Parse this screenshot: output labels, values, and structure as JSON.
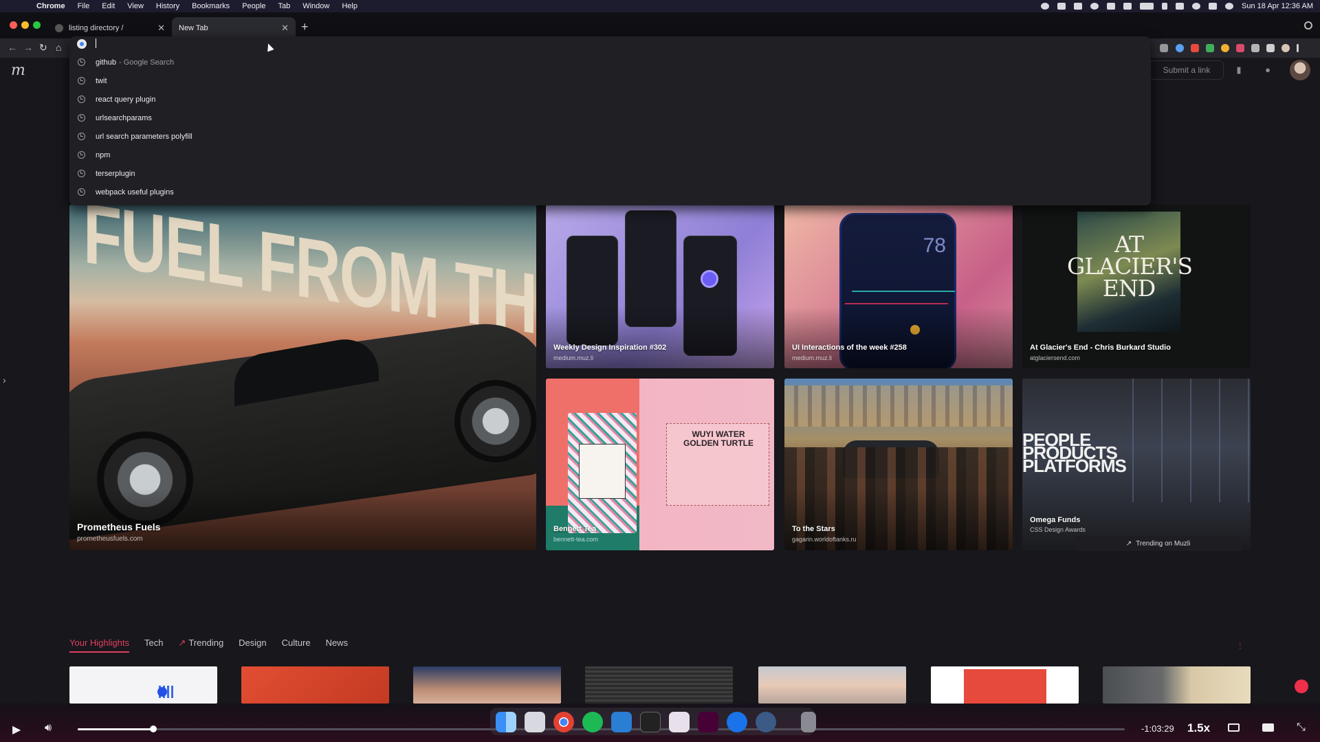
{
  "menubar": {
    "app_name": "Chrome",
    "items": [
      "File",
      "Edit",
      "View",
      "History",
      "Bookmarks",
      "People",
      "Tab",
      "Window",
      "Help"
    ],
    "clock": "Sun 18 Apr  12:36 AM"
  },
  "tabs": [
    {
      "title": "listing directory /",
      "active": false
    },
    {
      "title": "New Tab",
      "active": true
    }
  ],
  "omnibox": {
    "value": "",
    "suggestions": [
      {
        "text": "github",
        "suffix": "- Google Search"
      },
      {
        "text": "twit",
        "suffix": ""
      },
      {
        "text": "react query plugin",
        "suffix": ""
      },
      {
        "text": "urlsearchparams",
        "suffix": ""
      },
      {
        "text": "url search parameters polyfill",
        "suffix": ""
      },
      {
        "text": "npm",
        "suffix": ""
      },
      {
        "text": "terserplugin",
        "suffix": ""
      },
      {
        "text": "webpack useful plugins",
        "suffix": ""
      }
    ]
  },
  "site": {
    "logo": "m",
    "submit_label": "Submit a link"
  },
  "cards": {
    "prom": {
      "title": "Prometheus Fuels",
      "source": "prometheusfuels.com",
      "art_text": "FUEL FROM THE AI"
    },
    "wdi": {
      "title": "Weekly Design Inspiration #302",
      "source": "medium.muz.li"
    },
    "ui": {
      "title": "UI Interactions of the week #258",
      "source": "medium.muz.li",
      "art_number": "78"
    },
    "glacier": {
      "title": "At Glacier's End - Chris Burkard Studio",
      "source": "atglaciersend.com",
      "art_text": "AT GLACIER'S END"
    },
    "bennett": {
      "title": "Bennett Tea",
      "source": "bennett-tea.com",
      "art_text": "WUYI WATER GOLDEN TURTLE"
    },
    "stars": {
      "title": "To the Stars",
      "source": "gagarin.worldoftanks.ru"
    },
    "omega": {
      "title": "Omega Funds",
      "source": "CSS Design Awards",
      "art_text": "PEOPLE PRODUCTS PLATFORMS"
    }
  },
  "trending_badge": "Trending on Muzli",
  "highlight_tabs": [
    "Your Highlights",
    "Tech",
    "Trending",
    "Design",
    "Culture",
    "News"
  ],
  "player": {
    "time_left": "-1:03:29",
    "speed": "1.5x",
    "progress": 0.072
  }
}
